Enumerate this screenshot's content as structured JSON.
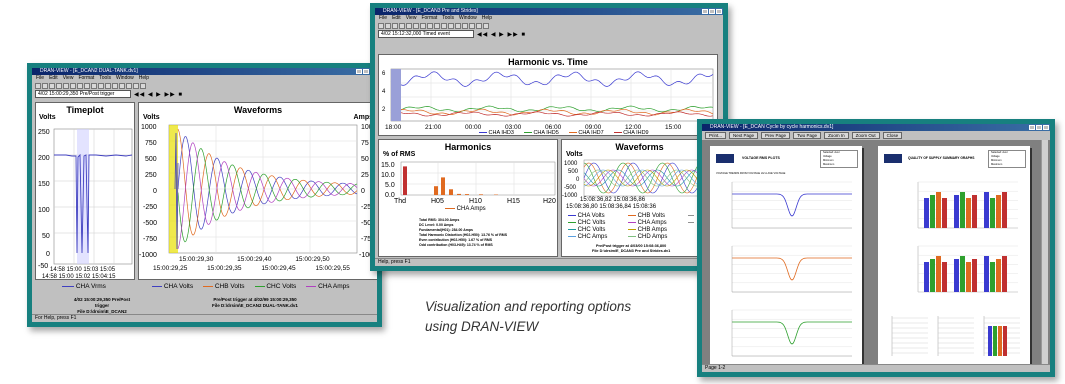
{
  "caption": {
    "line1": "Visualization and reporting options",
    "line2": "using DRAN-VIEW"
  },
  "win1": {
    "title": "DRAN-VIEW - [E_DCAN2 DUAL-TANK.dv1]",
    "menu": [
      "File",
      "Edit",
      "View",
      "Format",
      "Tools",
      "Window",
      "Help"
    ],
    "combo": "4/02 15:00:29,350  Pre/Post trigger",
    "timeplot": {
      "title": "Timeplot",
      "ylabel": "Volts",
      "yticks": [
        "250",
        "200",
        "150",
        "100",
        "50",
        "0",
        "-50"
      ],
      "xticks1": "14:58 15:00 15:03 15:05",
      "xticks2": "14:58 15:00 15:02 15:04:15",
      "legend": "CHA Vrms"
    },
    "waveforms": {
      "title": "Waveforms",
      "ylabel_left": "Volts",
      "ylabel_right": "Amps",
      "yticks_left": [
        "1000",
        "750",
        "500",
        "250",
        "0",
        "-250",
        "-500",
        "-750",
        "-1000"
      ],
      "yticks_right": [
        "100",
        "75",
        "50",
        "25",
        "0",
        "-25",
        "-50",
        "-75",
        "-100"
      ],
      "xticks_top": [
        "15:00:29,30",
        "15:00:29,40",
        "15:00:29,50"
      ],
      "xticks_bottom": [
        "15:00:29,25",
        "15:00:29,35",
        "15:00:29,45",
        "15:00:29,55"
      ],
      "legend": [
        "CHA Volts",
        "CHB Volts",
        "CHC Volts",
        "CHA Amps"
      ],
      "footer1": "Pre/Post trigger at 4/02/99 15:00:29,350",
      "footer2": "File D:\\drsim\\E_DCAN2 DUAL-TANK.dv1"
    },
    "bottom_text1": "4/02 15:00:29,350  Pre/Post trigger",
    "bottom_text2": "File D:\\drsim\\E_DCAN2 DUAL-TANK.dv1",
    "status": "For Help, press F1"
  },
  "win2": {
    "title": "DRAN-VIEW - [E_DCAN3 Pre and Strides]",
    "menu": [
      "File",
      "Edit",
      "View",
      "Format",
      "Tools",
      "Window",
      "Help"
    ],
    "combo": "4/02 15:12:32,000  Timed event",
    "harmonic_time": {
      "title": "Harmonic vs. Time",
      "yticks": [
        "6",
        "4",
        "2"
      ],
      "xticks": [
        "18:00",
        "21:00",
        "00:00",
        "03:00",
        "06:00",
        "09:00",
        "12:00",
        "15:00"
      ],
      "legend": [
        "CHA IHD3",
        "CHA IHD5",
        "CHA IHD7",
        "CHA IHD9"
      ],
      "colors": [
        "#3a3ad0",
        "#2ea02e",
        "#e06a20",
        "#c03030"
      ]
    },
    "harmonics": {
      "title": "Harmonics",
      "ylabel": "% of RMS",
      "yticks": [
        "15.0",
        "10.0",
        "5.0",
        "0.0"
      ],
      "xticks": [
        "Thd",
        "H05",
        "H10",
        "H15",
        "H20"
      ],
      "values": [
        13,
        4,
        8,
        2.6,
        0.5,
        0.4,
        0.3,
        0.2
      ],
      "legend": "CHA Amps",
      "stats": [
        "Total RMS: 304.00 Amps",
        "DC Level: 0.00 Amps",
        "Fundamental(H01): 284.00 Amps",
        "Total Harmonic Distortion (H02-H50): 13.76 % of RMS",
        "Even contribution (H02-H50): 1.67 % of RMS",
        "Odd contribution (H03-H49): 13.74 % of RMS"
      ]
    },
    "waveforms": {
      "title": "Waveforms",
      "ylabel": "Volts",
      "yticks": [
        "1000",
        "500",
        "0",
        "-500",
        "-1000"
      ],
      "xticks1": "15:08:36,82  15:08:36,86",
      "xticks2": "15:08:36,80  15:08:36,84  15:08:36",
      "legend": [
        "CHA Volts",
        "CHB Volts",
        "CHC Volts",
        "CHC Volts",
        "CHA Amps",
        "CHB Amps",
        "CHC Amps",
        "CHD Amps"
      ],
      "footer1": "Pre/Post trigger at 4/03/00 15:08:36,800",
      "footer2": "File D:\\drsim\\E_DCAN3 Pre and Strides.dv1"
    },
    "status": "Help, press F1"
  },
  "win3": {
    "title": "DRAN-VIEW - [E_DCAN Cycle by cycle harmonics.dv1]",
    "toolbar": [
      "Print...",
      "Next Page",
      "Prev Page",
      "Two Page",
      "Zoom In",
      "Zoom Out",
      "Close"
    ],
    "page1": {
      "title": "VOLTAGE RMS PLOTS",
      "subtitle": "VOLTAGE TRENDS FROM VOLTAGE HV-A-AVE VOLTAGE",
      "info": [
        "Selected: Aver",
        "Voltage",
        "Minimum",
        "Maximum"
      ]
    },
    "page2": {
      "title": "QUALITY OF SUPPLY SUMMARY GRAPHS",
      "info": [
        "Selected: Aver",
        "Voltage",
        "Minimum",
        "Maximum"
      ]
    },
    "status": "Page 1-2"
  }
}
